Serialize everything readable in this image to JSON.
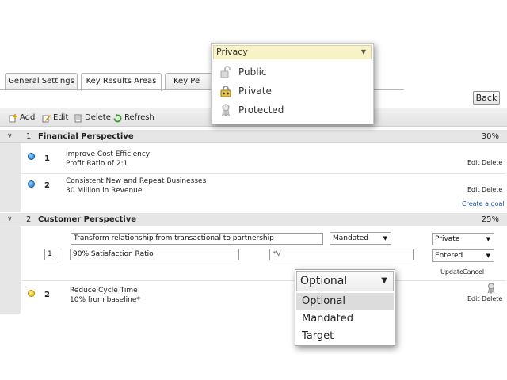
{
  "tabs": [
    "General Settings",
    "Key Results Areas",
    "Key Pe"
  ],
  "back_label": "Back",
  "toolbar": {
    "add": "Add",
    "edit": "Edit",
    "delete": "Delete",
    "refresh": "Refresh"
  },
  "sections": [
    {
      "num": "1",
      "title": "Financial Perspective",
      "pct": "30%"
    },
    {
      "num": "2",
      "title": "Customer Perspective",
      "pct": "25%"
    }
  ],
  "goals": [
    {
      "num": "1",
      "line1": "Improve Cost Efficiency",
      "line2": "Profit Ratio of 2:1",
      "actions": "Edit Delete"
    },
    {
      "num": "2",
      "line1": "Consistent New and Repeat Businesses",
      "line2": "30 Million in Revenue",
      "actions": "Edit Delete"
    },
    {
      "num": "2",
      "line1": "Reduce Cycle Time",
      "line2": "10% from baseline*",
      "actions": "Edit Delete"
    }
  ],
  "create_goal": "Create a goal",
  "edit_form": {
    "goal_name": "Transform relationship from transactional to partnership",
    "type_value": "Mandated",
    "privacy_value": "Private",
    "order_value": "1",
    "measure_value": "90% Satisfaction Ratio",
    "target_partial": "*V",
    "status_value": "Entered",
    "update": "Update",
    "cancel": "Cancel"
  },
  "privacy_popup": {
    "header": "Privacy",
    "options": [
      {
        "label": "Public",
        "icon": "unlock-icon"
      },
      {
        "label": "Private",
        "icon": "private-lock-icon"
      },
      {
        "label": "Protected",
        "icon": "ribbon-icon"
      }
    ]
  },
  "type_popup": {
    "selected": "Optional",
    "options": [
      "Optional",
      "Mandated",
      "Target"
    ]
  },
  "colors": {
    "blue_dot": "#1c6fd0",
    "yellow_dot": "#e0b400",
    "link": "#1a54a0",
    "privacy_header": "#f7f3c6"
  }
}
